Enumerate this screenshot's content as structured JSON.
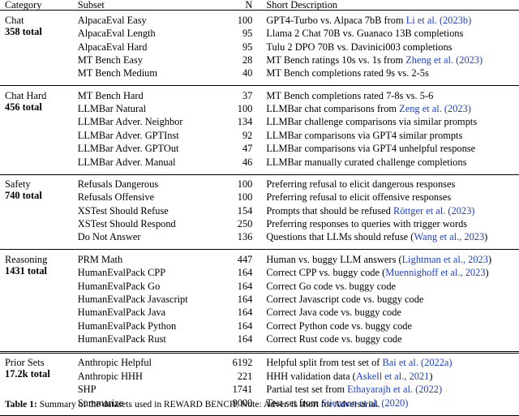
{
  "table": {
    "columns": [
      "Category",
      "Subset",
      "N",
      "Short Description"
    ],
    "sections": [
      {
        "category": "Chat",
        "total": "358 total",
        "rows": [
          {
            "subset": "AlpacaEval Easy",
            "n": "100",
            "desc_pre": "GPT4-Turbo vs. Alpaca 7bB from ",
            "cite": "Li et al. (2023b)",
            "desc_post": ""
          },
          {
            "subset": "AlpacaEval Length",
            "n": "95",
            "desc_pre": "Llama 2 Chat 70B vs. Guanaco 13B completions",
            "cite": "",
            "desc_post": ""
          },
          {
            "subset": "AlpacaEval Hard",
            "n": "95",
            "desc_pre": "Tulu 2 DPO 70B vs. Davinici003 completions",
            "cite": "",
            "desc_post": ""
          },
          {
            "subset": "MT Bench Easy",
            "n": "28",
            "desc_pre": "MT Bench ratings 10s vs. 1s from ",
            "cite": "Zheng et al. (2023)",
            "desc_post": ""
          },
          {
            "subset": "MT Bench Medium",
            "n": "40",
            "desc_pre": "MT Bench completions rated 9s vs. 2-5s",
            "cite": "",
            "desc_post": ""
          }
        ]
      },
      {
        "category": "Chat Hard",
        "total": "456 total",
        "rows": [
          {
            "subset": "MT Bench Hard",
            "n": "37",
            "desc_pre": "MT Bench completions rated 7-8s vs. 5-6",
            "cite": "",
            "desc_post": ""
          },
          {
            "subset": "LLMBar Natural",
            "n": "100",
            "desc_pre": "LLMBar chat comparisons from ",
            "cite": "Zeng et al. (2023)",
            "desc_post": ""
          },
          {
            "subset": "LLMBar Adver. Neighbor",
            "n": "134",
            "desc_pre": "LLMBar challenge comparisons via similar prompts",
            "cite": "",
            "desc_post": ""
          },
          {
            "subset": "LLMBar Adver. GPTInst",
            "n": "92",
            "desc_pre": "LLMBar comparisons via GPT4 similar prompts",
            "cite": "",
            "desc_post": ""
          },
          {
            "subset": "LLMBar Adver. GPTOut",
            "n": "47",
            "desc_pre": "LLMBar comparisons via GPT4 unhelpful response",
            "cite": "",
            "desc_post": ""
          },
          {
            "subset": "LLMBar Adver. Manual",
            "n": "46",
            "desc_pre": "LLMBar manually curated challenge completions",
            "cite": "",
            "desc_post": ""
          }
        ]
      },
      {
        "category": "Safety",
        "total": "740 total",
        "rows": [
          {
            "subset": "Refusals Dangerous",
            "n": "100",
            "desc_pre": "Preferring refusal to elicit dangerous responses",
            "cite": "",
            "desc_post": ""
          },
          {
            "subset": "Refusals Offensive",
            "n": "100",
            "desc_pre": "Preferring refusal to elicit offensive responses",
            "cite": "",
            "desc_post": ""
          },
          {
            "subset": "XSTest Should Refuse",
            "n": "154",
            "desc_pre": "Prompts that should be refused ",
            "cite": "Röttger et al. (2023)",
            "desc_post": ""
          },
          {
            "subset": "XSTest Should Respond",
            "n": "250",
            "desc_pre": "Preferring responses to queries with trigger words",
            "cite": "",
            "desc_post": ""
          },
          {
            "subset": "Do Not Answer",
            "n": "136",
            "desc_pre": "Questions that LLMs should refuse (",
            "cite": "Wang et al., 2023",
            "desc_post": ")"
          }
        ]
      },
      {
        "category": "Reasoning",
        "total": "1431 total",
        "rows": [
          {
            "subset": "PRM Math",
            "n": "447",
            "desc_pre": "Human vs. buggy LLM answers (",
            "cite": "Lightman et al., 2023",
            "desc_post": ")"
          },
          {
            "subset": "HumanEvalPack CPP",
            "n": "164",
            "desc_pre": "Correct CPP vs. buggy code (",
            "cite": "Muennighoff et al., 2023",
            "desc_post": ")"
          },
          {
            "subset": "HumanEvalPack Go",
            "n": "164",
            "desc_pre": "Correct Go code vs. buggy code",
            "cite": "",
            "desc_post": ""
          },
          {
            "subset": "HumanEvalPack Javascript",
            "n": "164",
            "desc_pre": "Correct Javascript code vs. buggy code",
            "cite": "",
            "desc_post": ""
          },
          {
            "subset": "HumanEvalPack Java",
            "n": "164",
            "desc_pre": "Correct Java code vs. buggy code",
            "cite": "",
            "desc_post": ""
          },
          {
            "subset": "HumanEvalPack Python",
            "n": "164",
            "desc_pre": "Correct Python code vs. buggy code",
            "cite": "",
            "desc_post": ""
          },
          {
            "subset": "HumanEvalPack Rust",
            "n": "164",
            "desc_pre": "Correct Rust code vs. buggy code",
            "cite": "",
            "desc_post": ""
          }
        ]
      },
      {
        "category": "Prior Sets",
        "total": "17.2k total",
        "rows": [
          {
            "subset": "Anthropic Helpful",
            "n": "6192",
            "desc_pre": "Helpful split from test set of ",
            "cite": "Bai et al. (2022a)",
            "desc_post": ""
          },
          {
            "subset": "Anthropic HHH",
            "n": "221",
            "desc_pre": "HHH validation data (",
            "cite": "Askell et al., 2021",
            "desc_post": ")"
          },
          {
            "subset": "SHP",
            "n": "1741",
            "desc_pre": "Partial test set from ",
            "cite": "Ethayarajh et al. (2022)",
            "desc_post": ""
          },
          {
            "subset": "Summarize",
            "n": "9000",
            "desc_pre": "Test set from ",
            "cite": "Stiennon et al. (2020)",
            "desc_post": ""
          }
        ]
      }
    ]
  },
  "caption": {
    "label": "Table 1:",
    "text_1": " Summary of the datasets used in ",
    "benchmark_name": "REWARD BENCH",
    "text_2": ". Note: Adver. is short for Adversarial."
  },
  "colors": {
    "citation_link": "#1a3fcc",
    "text": "#000000",
    "background": "#ffffff"
  }
}
